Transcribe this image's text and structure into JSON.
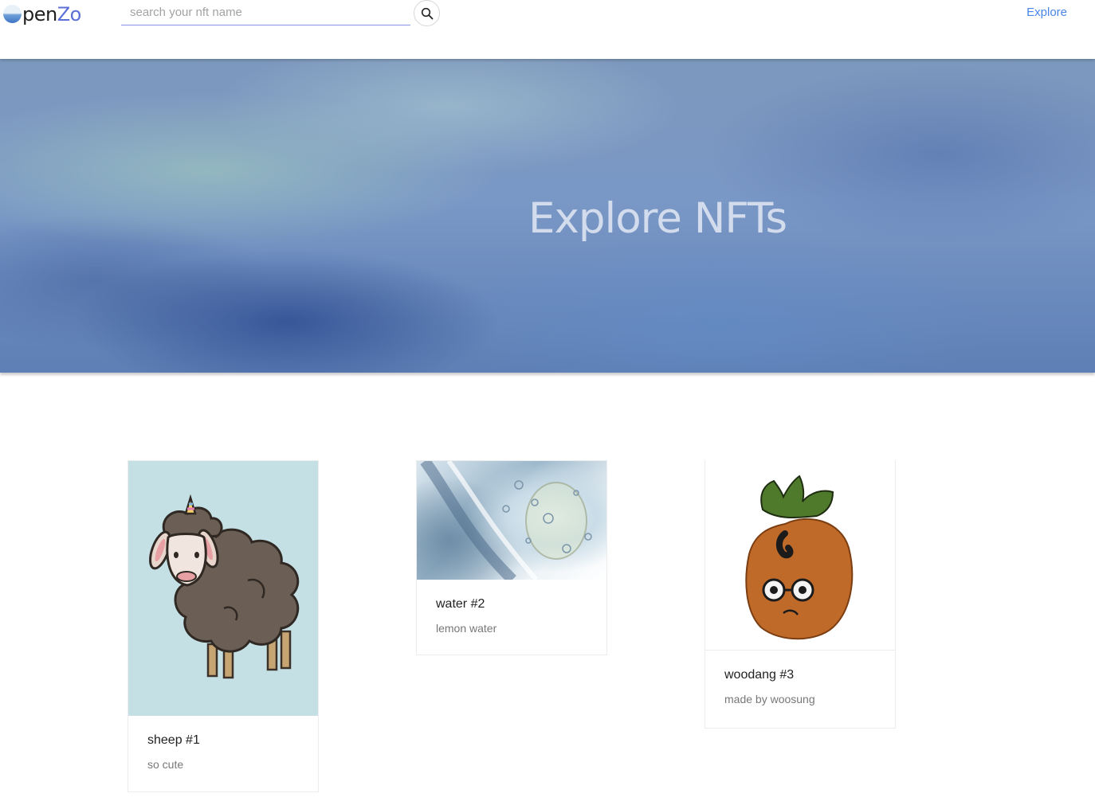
{
  "brand": {
    "logo_text_dark": "pen",
    "logo_text_accent": "Zo"
  },
  "search": {
    "placeholder": "search your nft name"
  },
  "nav": {
    "explore_label": "Explore"
  },
  "hero": {
    "title": "Explore NFTs"
  },
  "cards": [
    {
      "title": "sheep #1",
      "description": "so cute",
      "image": "sheep-unicorn-illustration"
    },
    {
      "title": "water #2",
      "description": "lemon water",
      "image": "water-bubbles-photo"
    },
    {
      "title": "woodang #3",
      "description": "made by woosung",
      "image": "pineapple-character-illustration"
    }
  ],
  "colors": {
    "accent": "#4a86e8",
    "logo_accent": "#5b6fd6",
    "search_underline": "#8c94e8",
    "card_bg_sheep": "#c4e0e5"
  }
}
